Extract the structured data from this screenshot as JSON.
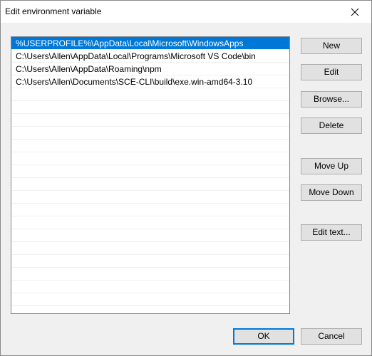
{
  "window": {
    "title": "Edit environment variable"
  },
  "icons": {
    "close": "close-icon"
  },
  "list": {
    "items": [
      "%USERPROFILE%\\AppData\\Local\\Microsoft\\WindowsApps",
      "C:\\Users\\Allen\\AppData\\Local\\Programs\\Microsoft VS Code\\bin",
      "C:\\Users\\Allen\\AppData\\Roaming\\npm",
      "C:\\Users\\Allen\\Documents\\SCE-CLI\\build\\exe.win-amd64-3.10"
    ],
    "selected_index": 0
  },
  "buttons": {
    "new": "New",
    "edit": "Edit",
    "browse": "Browse...",
    "delete": "Delete",
    "move_up": "Move Up",
    "move_down": "Move Down",
    "edit_text": "Edit text...",
    "ok": "OK",
    "cancel": "Cancel"
  },
  "colors": {
    "selection": "#0078d7",
    "accent_border": "#0078d7"
  }
}
